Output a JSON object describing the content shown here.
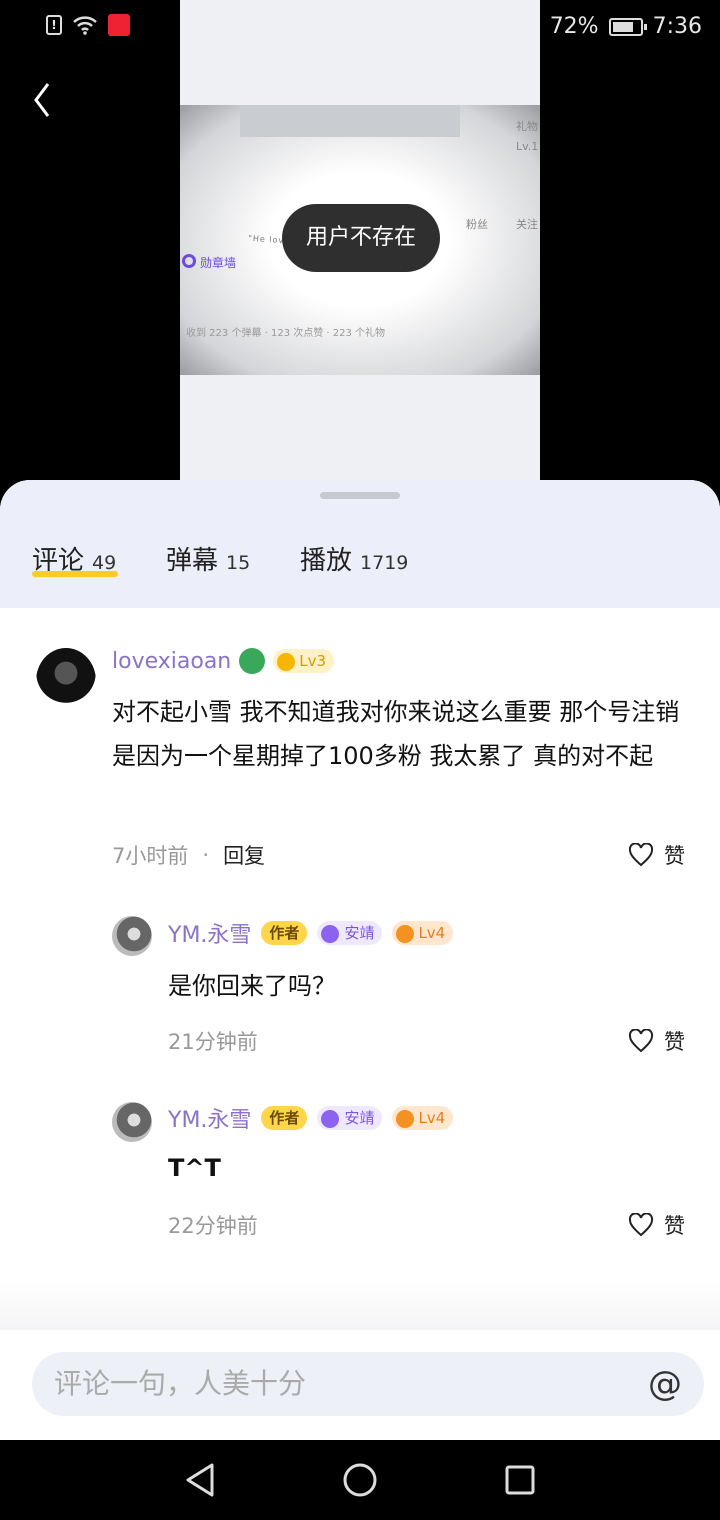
{
  "status": {
    "battery": "72%",
    "time": "7:36",
    "sim": "!"
  },
  "video": {
    "toast": "用户不存在",
    "medal": "勋章墙",
    "stats": "收到 223 个弹幕 · 123 次点赞 · 223 个礼物",
    "fans": "粉丝",
    "follow": "关注",
    "gift": "礼物",
    "level": "Lv.1",
    "quote": "\"He loves you to as much as he can\""
  },
  "tabs": [
    {
      "label": "评论",
      "count": "49"
    },
    {
      "label": "弹幕",
      "count": "15"
    },
    {
      "label": "播放",
      "count": "1719"
    }
  ],
  "comment": {
    "username": "lovexiaoan",
    "level": "Lv3",
    "text": "对不起小雪 我不知道我对你来说这么重要 那个号注销是因为一个星期掉了100多粉 我太累了 真的对不起",
    "time": "7小时前",
    "separator": "·",
    "reply_label": "回复",
    "like_label": "赞"
  },
  "replies": [
    {
      "username": "YM.永雪",
      "author_badge": "作者",
      "title_badge": "安靖",
      "level": "Lv4",
      "text": "是你回来了吗？",
      "time": "21分钟前",
      "like_label": "赞"
    },
    {
      "username": "YM.永雪",
      "author_badge": "作者",
      "title_badge": "安靖",
      "level": "Lv4",
      "text": "T^T",
      "time": "22分钟前",
      "like_label": "赞"
    }
  ],
  "input": {
    "placeholder": "评论一句，人美十分",
    "at": "@"
  },
  "colors": {
    "accent": "#ffc926",
    "username": "#8b72c8",
    "header_bg": "#eceef9"
  }
}
